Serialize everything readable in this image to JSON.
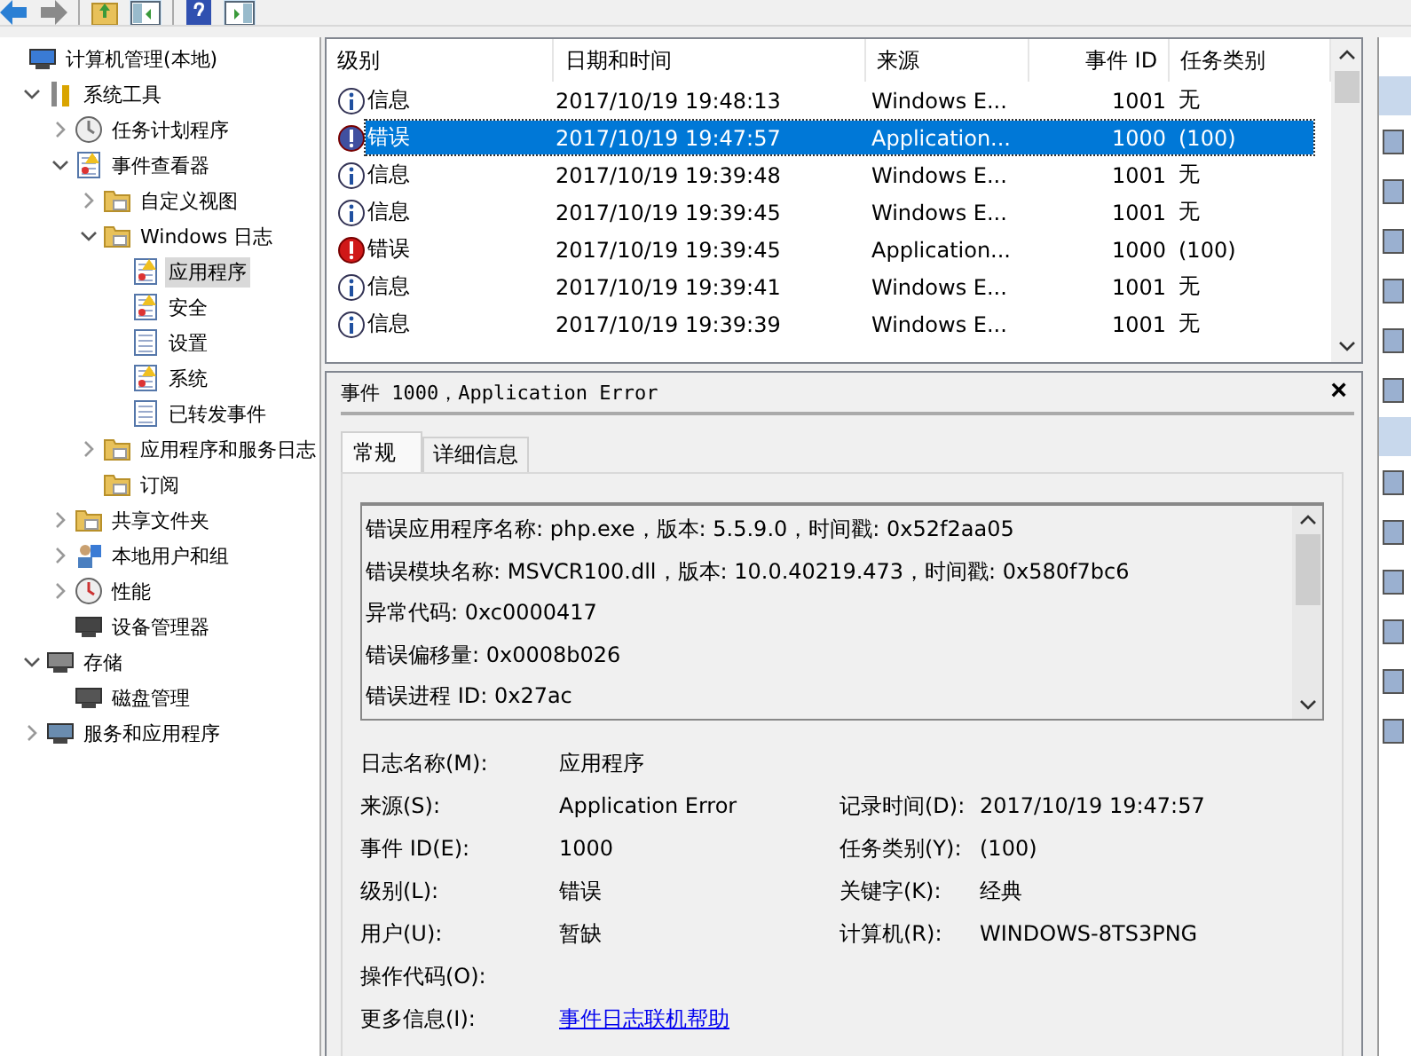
{
  "tree": [
    {
      "label": "计算机管理(本地)",
      "kind": "computer",
      "selected": false,
      "children": [
        {
          "label": "系统工具",
          "kind": "tools",
          "expanded": true,
          "selected": false,
          "children": [
            {
              "label": "任务计划程序",
              "kind": "clock",
              "expanded": false,
              "selected": false
            },
            {
              "label": "事件查看器",
              "kind": "eventlog",
              "expanded": true,
              "selected": false,
              "children": [
                {
                  "label": "自定义视图",
                  "kind": "folder",
                  "expanded": false,
                  "selected": false
                },
                {
                  "label": "Windows 日志",
                  "kind": "folder",
                  "expanded": true,
                  "selected": false,
                  "children": [
                    {
                      "label": "应用程序",
                      "kind": "logwarn",
                      "selected": true
                    },
                    {
                      "label": "安全",
                      "kind": "logwarn",
                      "selected": false
                    },
                    {
                      "label": "设置",
                      "kind": "log",
                      "selected": false
                    },
                    {
                      "label": "系统",
                      "kind": "logwarn",
                      "selected": false
                    },
                    {
                      "label": "已转发事件",
                      "kind": "log",
                      "selected": false
                    }
                  ]
                },
                {
                  "label": "应用程序和服务日志",
                  "kind": "folder",
                  "expanded": false,
                  "selected": false
                },
                {
                  "label": "订阅",
                  "kind": "folder",
                  "selected": false
                }
              ]
            },
            {
              "label": "共享文件夹",
              "kind": "share",
              "expanded": false,
              "selected": false
            },
            {
              "label": "本地用户和组",
              "kind": "users",
              "expanded": false,
              "selected": false
            },
            {
              "label": "性能",
              "kind": "perf",
              "expanded": false,
              "selected": false
            },
            {
              "label": "设备管理器",
              "kind": "device",
              "selected": false
            }
          ]
        },
        {
          "label": "存储",
          "kind": "storage",
          "expanded": true,
          "selected": false,
          "children": [
            {
              "label": "磁盘管理",
              "kind": "disk",
              "selected": false
            }
          ]
        },
        {
          "label": "服务和应用程序",
          "kind": "services",
          "expanded": false,
          "selected": false
        }
      ]
    }
  ],
  "events": {
    "columns": [
      "级别",
      "日期和时间",
      "来源",
      "事件 ID",
      "任务类别"
    ],
    "rows": [
      {
        "kind": "info",
        "level": "信息",
        "datetime": "2017/10/19 19:48:13",
        "source": "Windows E...",
        "event_id": "1001",
        "task": "无",
        "selected": false
      },
      {
        "kind": "error",
        "level": "错误",
        "datetime": "2017/10/19 19:47:57",
        "source": "Application...",
        "event_id": "1000",
        "task": "(100)",
        "selected": true
      },
      {
        "kind": "info",
        "level": "信息",
        "datetime": "2017/10/19 19:39:48",
        "source": "Windows E...",
        "event_id": "1001",
        "task": "无",
        "selected": false
      },
      {
        "kind": "info",
        "level": "信息",
        "datetime": "2017/10/19 19:39:45",
        "source": "Windows E...",
        "event_id": "1001",
        "task": "无",
        "selected": false
      },
      {
        "kind": "error",
        "level": "错误",
        "datetime": "2017/10/19 19:39:45",
        "source": "Application...",
        "event_id": "1000",
        "task": "(100)",
        "selected": false
      },
      {
        "kind": "info",
        "level": "信息",
        "datetime": "2017/10/19 19:39:41",
        "source": "Windows E...",
        "event_id": "1001",
        "task": "无",
        "selected": false
      },
      {
        "kind": "info",
        "level": "信息",
        "datetime": "2017/10/19 19:39:39",
        "source": "Windows E...",
        "event_id": "1001",
        "task": "无",
        "selected": false
      }
    ]
  },
  "details": {
    "title": "事件 1000，Application Error",
    "close": "×",
    "tabs": [
      {
        "label": "常规",
        "selected": true
      },
      {
        "label": "详细信息",
        "selected": false
      }
    ],
    "description": [
      "错误应用程序名称: php.exe，版本: 5.5.9.0，时间戳: 0x52f2aa05",
      "错误模块名称: MSVCR100.dll，版本: 10.0.40219.473，时间戳: 0x580f7bc6",
      "异常代码: 0xc0000417",
      "错误偏移量: 0x0008b026",
      "错误进程 ID: 0x27ac"
    ],
    "fields": [
      {
        "label": "日志名称(M):",
        "value": "应用程序",
        "kind": "text"
      },
      {
        "label": "来源(S):",
        "value": "Application Error",
        "kind": "text",
        "label2": "记录时间(D):",
        "value2": "2017/10/19 19:47:57"
      },
      {
        "label": "事件 ID(E):",
        "value": "1000",
        "kind": "text",
        "label2": "任务类别(Y):",
        "value2": "(100)"
      },
      {
        "label": "级别(L):",
        "value": "错误",
        "kind": "text",
        "label2": "关键字(K):",
        "value2": "经典"
      },
      {
        "label": "用户(U):",
        "value": "暂缺",
        "kind": "text",
        "label2": "计算机(R):",
        "value2": "WINDOWS-8TS3PNG"
      },
      {
        "label": "操作代码(O):",
        "kind": "text"
      },
      {
        "label": "更多信息(I):",
        "value": "事件日志联机帮助",
        "kind": "link"
      }
    ]
  }
}
